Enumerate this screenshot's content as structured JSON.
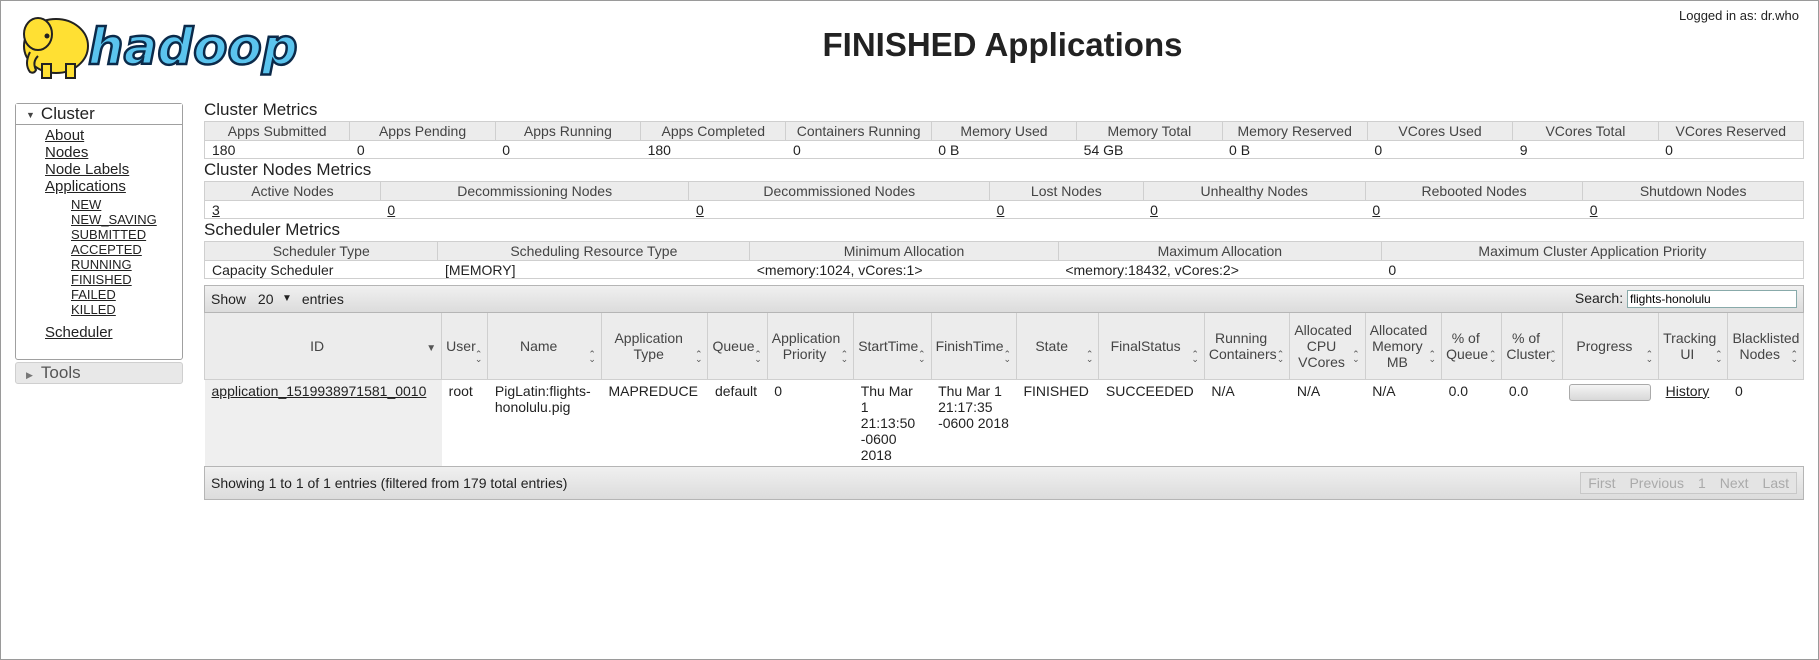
{
  "header": {
    "logo_text": "hadoop",
    "page_title": "FINISHED Applications",
    "logged_in": "Logged in as: dr.who"
  },
  "sidebar": {
    "cluster_label": "Cluster",
    "items": [
      "About",
      "Nodes",
      "Node Labels",
      "Applications"
    ],
    "app_states": [
      "NEW",
      "NEW_SAVING",
      "SUBMITTED",
      "ACCEPTED",
      "RUNNING",
      "FINISHED",
      "FAILED",
      "KILLED"
    ],
    "scheduler": "Scheduler",
    "tools_label": "Tools"
  },
  "cluster_metrics": {
    "title": "Cluster Metrics",
    "headers": [
      "Apps Submitted",
      "Apps Pending",
      "Apps Running",
      "Apps Completed",
      "Containers Running",
      "Memory Used",
      "Memory Total",
      "Memory Reserved",
      "VCores Used",
      "VCores Total",
      "VCores Reserved"
    ],
    "values": [
      "180",
      "0",
      "0",
      "180",
      "0",
      "0 B",
      "54 GB",
      "0 B",
      "0",
      "9",
      "0"
    ]
  },
  "nodes_metrics": {
    "title": "Cluster Nodes Metrics",
    "headers": [
      "Active Nodes",
      "Decommissioning Nodes",
      "Decommissioned Nodes",
      "Lost Nodes",
      "Unhealthy Nodes",
      "Rebooted Nodes",
      "Shutdown Nodes"
    ],
    "values": [
      "3",
      "0",
      "0",
      "0",
      "0",
      "0",
      "0"
    ]
  },
  "scheduler_metrics": {
    "title": "Scheduler Metrics",
    "headers": [
      "Scheduler Type",
      "Scheduling Resource Type",
      "Minimum Allocation",
      "Maximum Allocation",
      "Maximum Cluster Application Priority"
    ],
    "values": [
      "Capacity Scheduler",
      "[MEMORY]",
      "<memory:1024, vCores:1>",
      "<memory:18432, vCores:2>",
      "0"
    ]
  },
  "table_controls": {
    "show_label": "Show",
    "entries_value": "20",
    "entries_label": "entries",
    "search_label": "Search:",
    "search_value": "flights-honolulu"
  },
  "apps_table": {
    "headers": [
      "ID",
      "User",
      "Name",
      "Application Type",
      "Queue",
      "Application Priority",
      "StartTime",
      "FinishTime",
      "State",
      "FinalStatus",
      "Running Containers",
      "Allocated CPU VCores",
      "Allocated Memory MB",
      "% of Queue",
      "% of Cluster",
      "Progress",
      "Tracking UI",
      "Blacklisted Nodes"
    ],
    "row": {
      "id": "application_1519938971581_0010",
      "user": "root",
      "name": "PigLatin:flights-honolulu.pig",
      "type": "MAPREDUCE",
      "queue": "default",
      "priority": "0",
      "start": "Thu Mar 1 21:13:50 -0600 2018",
      "finish": "Thu Mar 1 21:17:35 -0600 2018",
      "state": "FINISHED",
      "final_status": "SUCCEEDED",
      "running_containers": "N/A",
      "alloc_vcores": "N/A",
      "alloc_memory": "N/A",
      "pct_queue": "0.0",
      "pct_cluster": "0.0",
      "progress": 0,
      "tracking_ui": "History",
      "blacklisted": "0"
    }
  },
  "footer": {
    "info": "Showing 1 to 1 of 1 entries (filtered from 179 total entries)",
    "pager": [
      "First",
      "Previous",
      "1",
      "Next",
      "Last"
    ]
  }
}
